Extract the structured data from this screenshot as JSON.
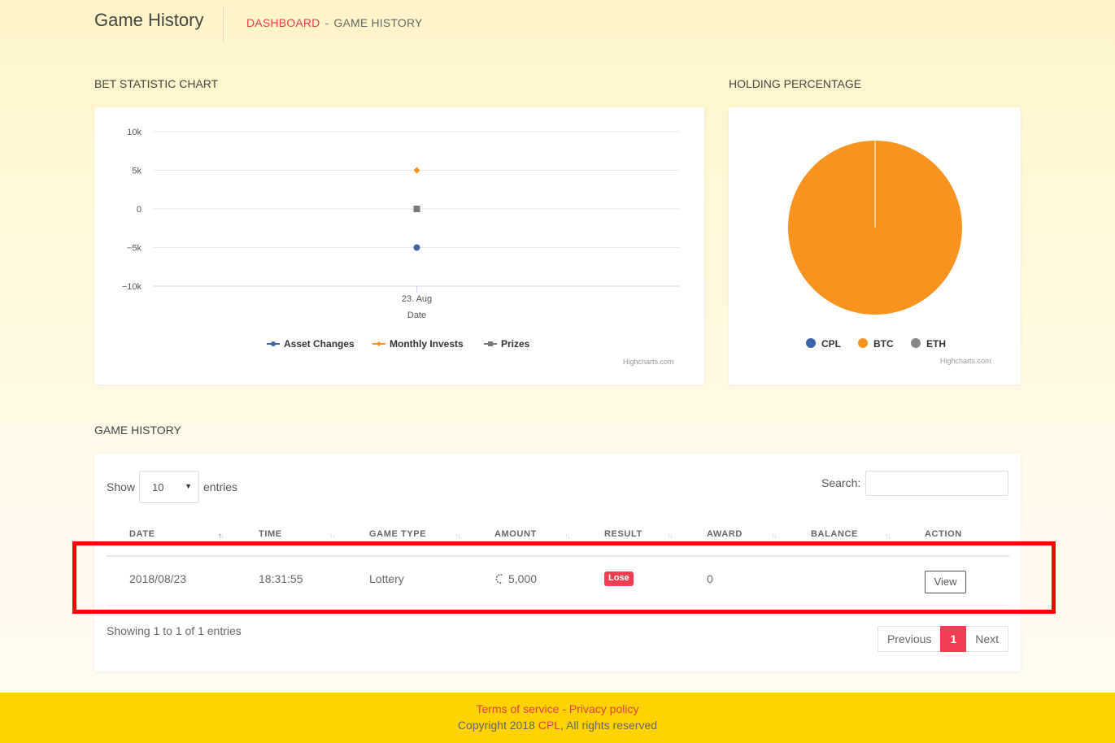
{
  "header": {
    "title": "Game History",
    "breadcrumb": {
      "home": "DASHBOARD",
      "separator": "-",
      "current": "GAME HISTORY"
    }
  },
  "bet_chart": {
    "section_title": "BET STATISTIC CHART",
    "credit": "Highcharts.com"
  },
  "holding_chart": {
    "section_title": "HOLDING PERCENTAGE",
    "credit": "Highcharts.com"
  },
  "chart_data": [
    {
      "type": "scatter",
      "x": [
        "23. Aug"
      ],
      "xlabel": "Date",
      "ylabel": "",
      "yticks": [
        "10k",
        "5k",
        "0",
        "−5k",
        "−10k"
      ],
      "ylim": [
        -10000,
        10000
      ],
      "grid": true,
      "legend": "bottom-center",
      "series": [
        {
          "name": "Asset Changes",
          "values": [
            -5000
          ],
          "color": "#3c64a8",
          "marker": "circle"
        },
        {
          "name": "Monthly Invests",
          "values": [
            5000
          ],
          "color": "#f7931e",
          "marker": "diamond"
        },
        {
          "name": "Prizes",
          "values": [
            0
          ],
          "color": "#777777",
          "marker": "square"
        }
      ]
    },
    {
      "type": "pie",
      "legend": "bottom-center",
      "categories": [
        "CPL",
        "BTC",
        "ETH"
      ],
      "values": [
        0,
        100,
        0
      ],
      "colors": [
        "#3c64a8",
        "#f7931e",
        "#888888"
      ]
    }
  ],
  "history": {
    "section_title": "GAME HISTORY",
    "show_label": "Show",
    "entries_label": "entries",
    "page_size": "10",
    "search_label": "Search:",
    "search_value": "",
    "columns": [
      "DATE",
      "TIME",
      "GAME TYPE",
      "AMOUNT",
      "RESULT",
      "AWARD",
      "BALANCE",
      "ACTION"
    ],
    "rows": [
      {
        "date": "2018/08/23",
        "time": "18:31:55",
        "game_type": "Lottery",
        "amount": "5,000",
        "result": "Lose",
        "award": "0",
        "balance": "",
        "action": "View"
      }
    ],
    "info": "Showing 1 to 1 of 1 entries",
    "pagination": {
      "previous": "Previous",
      "current": "1",
      "next": "Next"
    }
  },
  "footer": {
    "terms": "Terms of service",
    "separator": " - ",
    "privacy": "Privacy policy",
    "copyright_prefix": "Copyright 2018 ",
    "brand": "CPL",
    "copyright_suffix": ", All rights reserved"
  },
  "colors": {
    "accent": "#f23d52",
    "footer": "#ffd200",
    "btc": "#f7931e",
    "cpl": "#3c64a8"
  }
}
